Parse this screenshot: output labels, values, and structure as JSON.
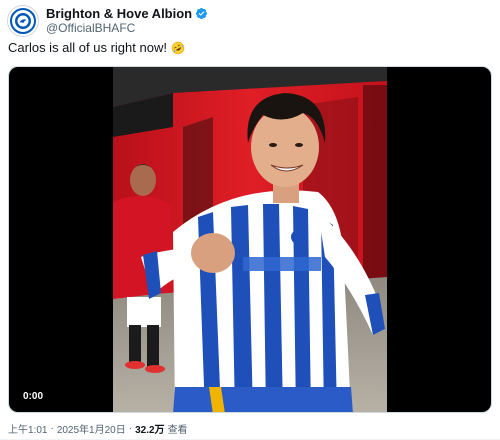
{
  "account": {
    "display_name": "Brighton & Hove Albion",
    "handle": "@OfficialBHAFC",
    "verified_icon": "verified-badge-icon",
    "avatar_icon": "club-crest-icon"
  },
  "tweet": {
    "text": "Carlos is all of us right now!",
    "emoji_icon": "rolling-on-floor-laughing-icon"
  },
  "video": {
    "elapsed": "0:00"
  },
  "meta": {
    "time": "上午1:01",
    "separator": "·",
    "date": "2025年1月20日",
    "views_count": "32.2万",
    "views_label": "查看"
  },
  "colors": {
    "accent": "#1d9bf0",
    "brand_blue": "#0057b8",
    "secondary_text": "#536471"
  }
}
